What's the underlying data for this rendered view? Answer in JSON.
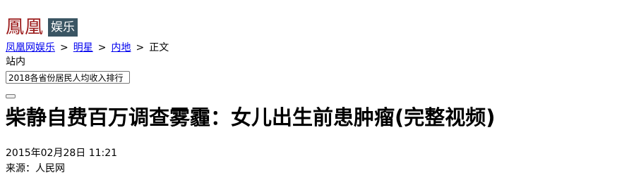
{
  "logo": {
    "main": "鳳凰",
    "sub": "娱乐"
  },
  "breadcrumb": {
    "items": [
      "凤凰网娱乐",
      "明星",
      "内地"
    ],
    "current": "正文",
    "separator": ">"
  },
  "search": {
    "scope_label": "站内",
    "input_value": "2018各省份居民人均收入排行"
  },
  "article": {
    "title": "柴静自费百万调查雾霾：女儿出生前患肿瘤(完整视频)",
    "datetime": "2015年02月28日 11:21",
    "source": "来源：人民网"
  },
  "colors": {
    "logo_red": "#9b1b1b",
    "logo_sub_bg": "#3a5563",
    "link": "#0000ee"
  }
}
